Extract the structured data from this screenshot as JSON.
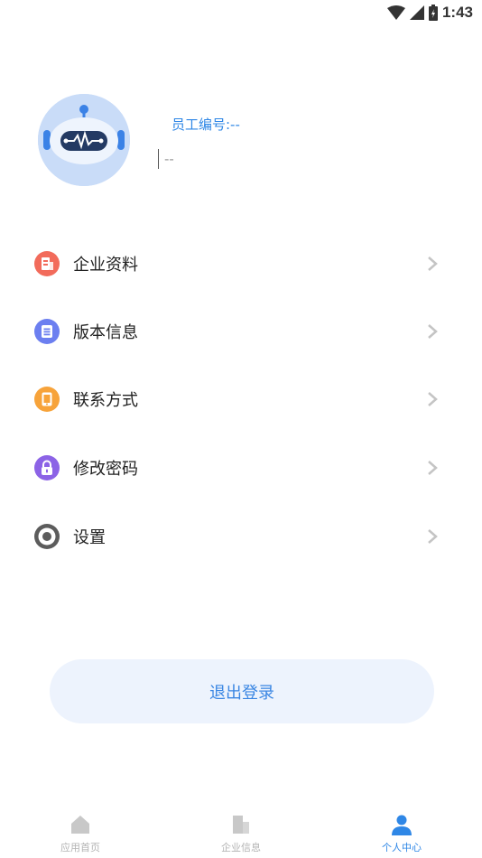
{
  "status_bar": {
    "time": "1:43",
    "icons": [
      "wifi-icon",
      "signal-icon",
      "battery-charging-icon"
    ]
  },
  "profile": {
    "avatar": "robot-avatar",
    "employee_id_label": "员工编号:--",
    "name_value": "--"
  },
  "menu": {
    "items": [
      {
        "label": "企业资料",
        "icon": "building-icon",
        "color": "#f26b5b"
      },
      {
        "label": "版本信息",
        "icon": "document-icon",
        "color": "#6c7ff0"
      },
      {
        "label": "联系方式",
        "icon": "phone-icon",
        "color": "#f7a33a"
      },
      {
        "label": "修改密码",
        "icon": "lock-icon",
        "color": "#8c63e6"
      },
      {
        "label": "设置",
        "icon": "settings-icon",
        "color": "#5c5c5c"
      }
    ],
    "chevron_icon": "chevron-right-icon"
  },
  "logout": {
    "label": "退出登录"
  },
  "bottom_nav": {
    "tabs": [
      {
        "label": "应用首页",
        "icon": "home-icon",
        "active": false
      },
      {
        "label": "企业信息",
        "icon": "buildings-icon",
        "active": false
      },
      {
        "label": "个人中心",
        "icon": "person-icon",
        "active": true
      }
    ]
  },
  "colors": {
    "accent": "#2f87e6",
    "logout_bg": "#edf3fd",
    "inactive_nav": "#b3b3b3"
  }
}
